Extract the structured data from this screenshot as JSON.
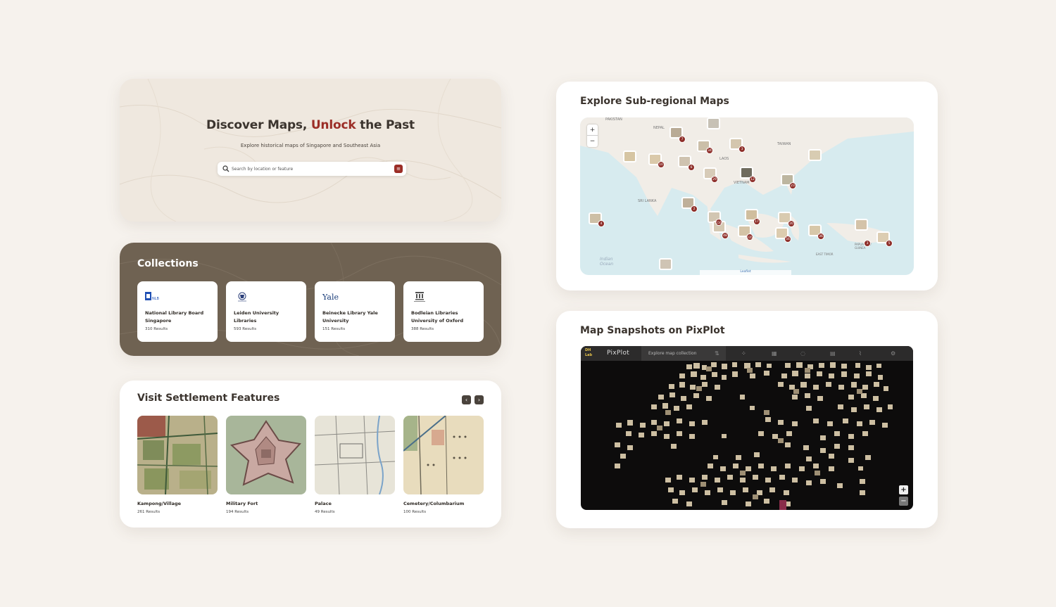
{
  "hero": {
    "title_pre": "Discover Maps, ",
    "title_accent": "Unlock",
    "title_post": " the Past",
    "subtitle": "Explore historical maps of Singapore and Southeast Asia",
    "search_placeholder": "Search by location or feature",
    "accent_color": "#9b2d26"
  },
  "collections": {
    "title": "Collections",
    "items": [
      {
        "name": "National Library Board Singapore",
        "count": "310 Results",
        "logo_text": "NLB"
      },
      {
        "name": "Leiden University Libraries",
        "count": "593 Results",
        "logo_text": ""
      },
      {
        "name": "Beinecke Library Yale University",
        "count": "151 Results",
        "logo_text": "Yale"
      },
      {
        "name": "Bodleian Libraries University of Oxford",
        "count": "388 Results",
        "logo_text": ""
      }
    ]
  },
  "settlement": {
    "title": "Visit Settlement Features",
    "prev": "‹",
    "next": "›",
    "items": [
      {
        "name": "Kampong/Village",
        "count": "261 Results"
      },
      {
        "name": "Military Fort",
        "count": "194 Results"
      },
      {
        "name": "Palace",
        "count": "49 Results"
      },
      {
        "name": "Cemetery/Columbarium",
        "count": "100 Results"
      }
    ]
  },
  "subregional": {
    "title": "Explore Sub-regional Maps",
    "zoom_in": "+",
    "zoom_out": "−",
    "attribution": "Leaflet",
    "labels": [
      "PAKISTAN",
      "NEPAL",
      "TAIWAN",
      "LAOS",
      "VIETNAM",
      "SRI LANKA",
      "Indian Ocean",
      "EAST TIMOR",
      "PAPUA NEW GUINEA"
    ],
    "clusters": [
      "7",
      "34",
      "3",
      "10",
      "6",
      "29",
      "12",
      "23",
      "2",
      "4",
      "116",
      "17",
      "20",
      "48",
      "235",
      "56",
      "36",
      "3",
      "5"
    ]
  },
  "pixplot": {
    "title": "Map Snapshots on PixPlot",
    "app_name": "PixPlot",
    "logo_text": "DH Lab",
    "link": "Explore map collection",
    "zoom_in": "+",
    "zoom_out": "−"
  }
}
